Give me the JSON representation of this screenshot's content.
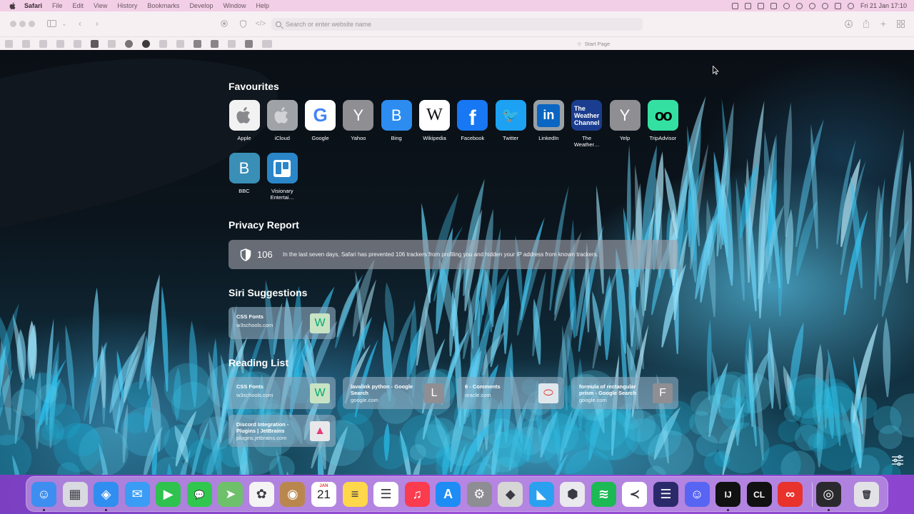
{
  "menubar": {
    "app_name": "Safari",
    "menus": [
      "File",
      "Edit",
      "View",
      "History",
      "Bookmarks",
      "Develop",
      "Window",
      "Help"
    ],
    "clock": "Fri 21 Jan  17:10"
  },
  "toolbar": {
    "address_placeholder": "Search or enter website name"
  },
  "tab": {
    "title": "Start Page"
  },
  "favourites": {
    "title": "Favourites",
    "items": [
      {
        "label": "Apple",
        "icon": "apple-icon",
        "bg": "#f2f2f2",
        "glyph": ""
      },
      {
        "label": "iCloud",
        "icon": "apple-icon",
        "bg": "#9fa3a8",
        "glyph": ""
      },
      {
        "label": "Google",
        "icon": "google-icon",
        "bg": "#ffffff",
        "glyph": "G"
      },
      {
        "label": "Yahoo",
        "icon": "letter-y-icon",
        "bg": "#8e8e93",
        "glyph": "Y"
      },
      {
        "label": "Bing",
        "icon": "letter-b-icon",
        "bg": "#2d8cf0",
        "glyph": "B"
      },
      {
        "label": "Wikipedia",
        "icon": "wikipedia-icon",
        "bg": "#ffffff",
        "glyph": "W"
      },
      {
        "label": "Facebook",
        "icon": "facebook-icon",
        "bg": "#1877f2",
        "glyph": "f"
      },
      {
        "label": "Twitter",
        "icon": "twitter-icon",
        "bg": "#1da1f2",
        "glyph": "🐦"
      },
      {
        "label": "LinkedIn",
        "icon": "linkedin-icon",
        "bg": "#9aa0a6",
        "glyph": "in"
      },
      {
        "label": "The Weather…",
        "icon": "weather-channel-icon",
        "bg": "#1b3d8f",
        "glyph": "The Weather Channel"
      },
      {
        "label": "Yelp",
        "icon": "letter-y-icon",
        "bg": "#8e8e93",
        "glyph": "Y"
      },
      {
        "label": "TripAdvisor",
        "icon": "tripadvisor-icon",
        "bg": "#34e0a1",
        "glyph": "oo"
      },
      {
        "label": "BBC",
        "icon": "letter-b-icon",
        "bg": "#3a8fb7",
        "glyph": "B"
      },
      {
        "label": "Visionary Entertai…",
        "icon": "trello-icon",
        "bg": "#2a86c9",
        "glyph": ""
      }
    ]
  },
  "privacy": {
    "title": "Privacy Report",
    "count": "106",
    "text": "In the last seven days, Safari has prevented 106 trackers from profiling you and hidden your IP address from known trackers."
  },
  "siri": {
    "title": "Siri Suggestions",
    "items": [
      {
        "title": "CSS Fonts",
        "subtitle": "w3schools.com",
        "thumb_bg": "#c7e3c4",
        "thumb_glyph": "W",
        "thumb_color": "#04aa6d"
      }
    ]
  },
  "reading_list": {
    "title": "Reading List",
    "items": [
      {
        "title": "CSS Fonts",
        "subtitle": "w3schools.com",
        "thumb_bg": "#c7e3c4",
        "thumb_glyph": "W",
        "thumb_color": "#04aa6d"
      },
      {
        "title": "lavalink python - Google Search",
        "subtitle": "google.com",
        "thumb_bg": "#8e8e93",
        "thumb_glyph": "L",
        "thumb_color": "#ffffff"
      },
      {
        "title": "6 - Comments",
        "subtitle": "oracle.com",
        "thumb_bg": "#dfe7ec",
        "thumb_glyph": "⬭",
        "thumb_color": "#e0301e"
      },
      {
        "title": "formula of rectangular prism - Google Search",
        "subtitle": "google.com",
        "thumb_bg": "#8e8e93",
        "thumb_glyph": "F",
        "thumb_color": "#ffffff"
      },
      {
        "title": "Discord Integration - Plugins | JetBrains",
        "subtitle": "plugins.jetbrains.com",
        "thumb_bg": "#e8e8ea",
        "thumb_glyph": "▲",
        "thumb_color": "#e63b7a"
      }
    ]
  },
  "dock": {
    "calendar_month": "JAN",
    "calendar_day": "21",
    "apps": [
      {
        "name": "Finder",
        "icon": "finder-icon",
        "bg": "#3d8ef0",
        "glyph": "☺",
        "running": true
      },
      {
        "name": "Launchpad",
        "icon": "launchpad-icon",
        "bg": "#d9d9e0",
        "glyph": "▦",
        "running": false
      },
      {
        "name": "Safari",
        "icon": "safari-icon",
        "bg": "#2f8ef0",
        "glyph": "◈",
        "running": true
      },
      {
        "name": "Mail",
        "icon": "mail-icon",
        "bg": "#3a9cf5",
        "glyph": "✉",
        "running": false
      },
      {
        "name": "FaceTime",
        "icon": "facetime-icon",
        "bg": "#2fc24f",
        "glyph": "▶",
        "running": false
      },
      {
        "name": "Messages",
        "icon": "messages-icon",
        "bg": "#31c74f",
        "glyph": "💬",
        "running": false
      },
      {
        "name": "Maps",
        "icon": "maps-icon",
        "bg": "#6ec06a",
        "glyph": "➤",
        "running": false
      },
      {
        "name": "Photos",
        "icon": "photos-icon",
        "bg": "#f4f4f4",
        "glyph": "✿",
        "running": false
      },
      {
        "name": "Contacts",
        "icon": "contacts-icon",
        "bg": "#b9874e",
        "glyph": "◉",
        "running": false
      },
      {
        "name": "Calendar",
        "icon": "calendar-icon",
        "bg": "#ffffff",
        "glyph": "",
        "running": false
      },
      {
        "name": "Notes",
        "icon": "notes-icon",
        "bg": "#ffd74a",
        "glyph": "≡",
        "running": false
      },
      {
        "name": "Reminders",
        "icon": "reminders-icon",
        "bg": "#ffffff",
        "glyph": "☰",
        "running": false
      },
      {
        "name": "Music",
        "icon": "music-icon",
        "bg": "#fa3c4e",
        "glyph": "♫",
        "running": false
      },
      {
        "name": "App Store",
        "icon": "app-store-icon",
        "bg": "#1e8cf5",
        "glyph": "A",
        "running": false
      },
      {
        "name": "System Preferences",
        "icon": "system-preferences-icon",
        "bg": "#8d8d93",
        "glyph": "⚙",
        "running": false
      },
      {
        "name": "Roblox Studio",
        "icon": "roblox-icon",
        "bg": "#d6d6d6",
        "glyph": "◆",
        "running": false
      },
      {
        "name": "Roblox",
        "icon": "roblox-studio-icon",
        "bg": "#2aa0f0",
        "glyph": "◣",
        "running": false
      },
      {
        "name": "Blockbench",
        "icon": "cube-icon",
        "bg": "#e9e9ee",
        "glyph": "⬢",
        "running": false
      },
      {
        "name": "Spotify",
        "icon": "spotify-icon",
        "bg": "#1db954",
        "glyph": "≋",
        "running": false
      },
      {
        "name": "Visual Studio Code",
        "icon": "vscode-icon",
        "bg": "#ffffff",
        "glyph": "≺",
        "running": false
      },
      {
        "name": "Lines",
        "icon": "striped-circle-icon",
        "bg": "#2a2a6a",
        "glyph": "☰",
        "running": false
      },
      {
        "name": "Discord",
        "icon": "discord-icon",
        "bg": "#5865f2",
        "glyph": "☺",
        "running": false
      },
      {
        "name": "IntelliJ IDEA",
        "icon": "intellij-icon",
        "bg": "#111111",
        "glyph": "IJ",
        "running": true
      },
      {
        "name": "CLion",
        "icon": "clion-icon",
        "bg": "#111111",
        "glyph": "CL",
        "running": false
      },
      {
        "name": "Creative Cloud",
        "icon": "creative-cloud-icon",
        "bg": "#e8322b",
        "glyph": "∞",
        "running": false
      },
      {
        "name": "OBS",
        "icon": "obs-icon",
        "bg": "#2a2a2e",
        "glyph": "◎",
        "running": true
      },
      {
        "name": "Trash",
        "icon": "trash-icon",
        "bg": "#e2e2e6",
        "glyph": "🗑",
        "running": false
      }
    ]
  }
}
